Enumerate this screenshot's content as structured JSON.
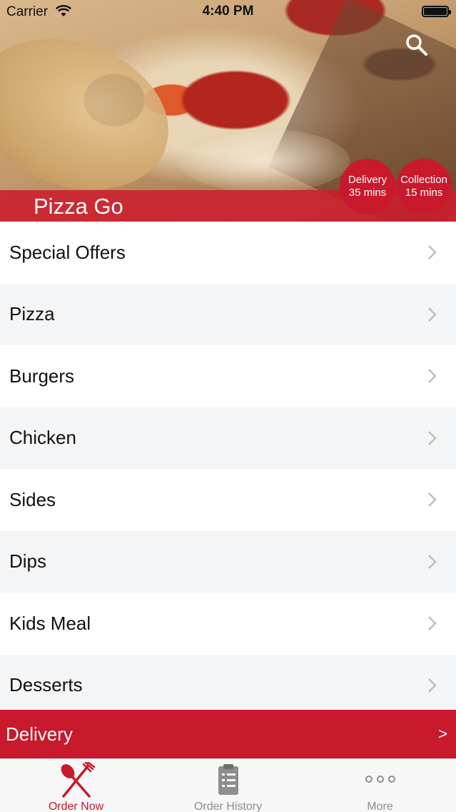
{
  "status_bar": {
    "carrier": "Carrier",
    "time": "4:40 PM"
  },
  "header": {
    "restaurant_name": "Pizza Go"
  },
  "badges": {
    "delivery": {
      "label": "Delivery",
      "time": "35 mins"
    },
    "collection": {
      "label": "Collection",
      "time": "15 mins"
    }
  },
  "menu": {
    "categories": [
      {
        "label": "Special Offers"
      },
      {
        "label": "Pizza"
      },
      {
        "label": "Burgers"
      },
      {
        "label": "Chicken"
      },
      {
        "label": "Sides"
      },
      {
        "label": "Dips"
      },
      {
        "label": "Kids Meal"
      },
      {
        "label": "Desserts"
      }
    ]
  },
  "order_type_bar": {
    "label": "Delivery",
    "arrow": ">"
  },
  "tabbar": {
    "tabs": [
      {
        "label": "Order Now",
        "icon": "fork-knife-icon",
        "active": true
      },
      {
        "label": "Order History",
        "icon": "clipboard-icon",
        "active": false
      },
      {
        "label": "More",
        "icon": "more-dots-icon",
        "active": false
      }
    ]
  },
  "colors": {
    "accent": "#c8192d",
    "inactive": "#8e8e8e",
    "row_alt": "#f4f5f6"
  }
}
